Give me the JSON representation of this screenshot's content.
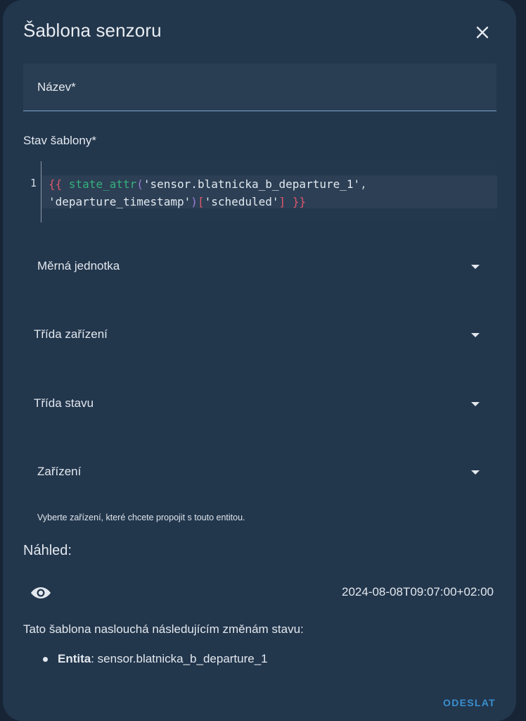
{
  "dialog": {
    "title": "Šablona senzoru",
    "close_icon": "close-icon"
  },
  "fields": {
    "name_label": "Název*",
    "template_label": "Stav šablony*",
    "code": {
      "line_number": "1",
      "tokens": {
        "open": "{{",
        "func": "state_attr",
        "lparen": "(",
        "arg1": "'sensor.blatnicka_b_departure_1'",
        "comma": ",",
        "arg2": "'departure_timestamp'",
        "rparen": ")",
        "lbracket": "[",
        "key": "'scheduled'",
        "rbracket": "]",
        "close": "}}"
      }
    },
    "unit_label": "Měrná jednotka",
    "device_class_label": "Třída zařízení",
    "state_class_label": "Třída stavu",
    "device_label": "Zařízení",
    "device_helper": "Vyberte zařízení, které chcete propojit s touto entitou."
  },
  "preview": {
    "label": "Náhled:",
    "icon": "eye-icon",
    "value": "2024-08-08T09:07:00+02:00",
    "listening_text": "Tato šablona naslouchá následujícím změnám stavu:",
    "entity_key": "Entita",
    "entity_value": ": sensor.blatnicka_b_departure_1"
  },
  "actions": {
    "submit_label": "ODESLAT"
  },
  "colors": {
    "dialog_bg": "#22364c",
    "accent": "#3a90d0"
  }
}
